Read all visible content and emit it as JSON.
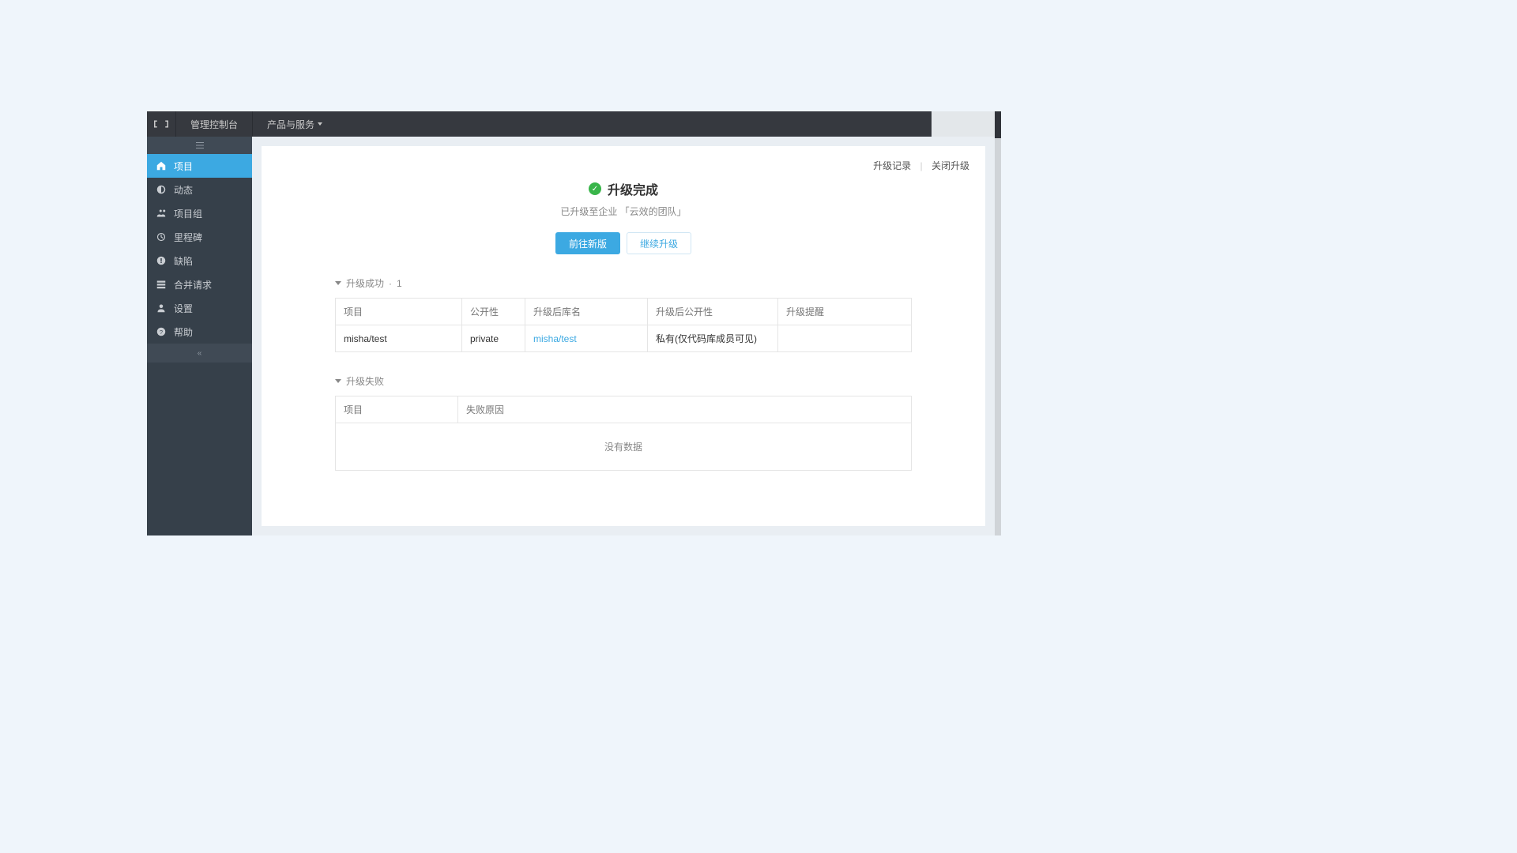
{
  "topbar": {
    "console_label": "管理控制台",
    "products_label": "产品与服务"
  },
  "sidebar": {
    "items": [
      {
        "label": "项目",
        "icon": "home-icon",
        "active": true
      },
      {
        "label": "动态",
        "icon": "dashboard-icon",
        "active": false
      },
      {
        "label": "项目组",
        "icon": "users-icon",
        "active": false
      },
      {
        "label": "里程碑",
        "icon": "clock-icon",
        "active": false
      },
      {
        "label": "缺陷",
        "icon": "alert-icon",
        "active": false
      },
      {
        "label": "合并请求",
        "icon": "merge-icon",
        "active": false
      },
      {
        "label": "设置",
        "icon": "user-icon",
        "active": false
      },
      {
        "label": "帮助",
        "icon": "question-icon",
        "active": false
      }
    ]
  },
  "panel": {
    "title": "升级完成",
    "subtitle": "已升级至企业 「云效的团队」",
    "goto_new": "前往新版",
    "continue_upgrade": "继续升级",
    "action_record": "升级记录",
    "action_close": "关闭升级"
  },
  "success": {
    "header": "升级成功",
    "count": "1",
    "columns": [
      "项目",
      "公开性",
      "升级后库名",
      "升级后公开性",
      "升级提醒"
    ],
    "rows": [
      {
        "project": "misha/test",
        "visibility": "private",
        "new_repo": "misha/test",
        "new_visibility": "私有(仅代码库成员可见)",
        "alert": ""
      }
    ]
  },
  "failure": {
    "header": "升级失败",
    "columns": [
      "项目",
      "失败原因"
    ],
    "empty": "没有数据"
  }
}
